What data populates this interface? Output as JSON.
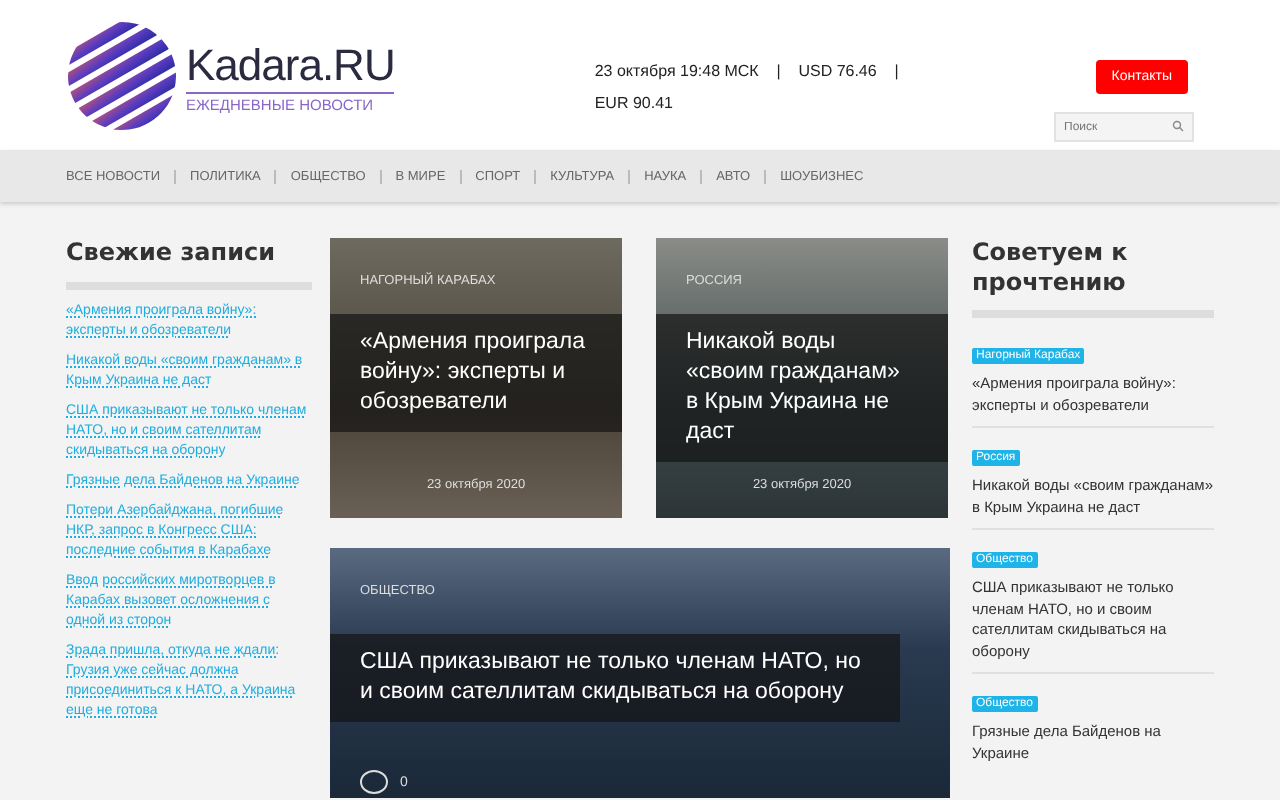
{
  "header": {
    "logo_name": "Kadara.RU",
    "logo_tagline": "ЕЖЕДНЕВНЫЕ НОВОСТИ",
    "info": "23 октября 19:48 МСК    |    USD 76.46    |    EUR 90.41",
    "contacts_button": "Контакты",
    "search": {
      "placeholder": "Поиск"
    }
  },
  "nav": [
    {
      "label": "ВСЕ НОВОСТИ"
    },
    {
      "label": "ПОЛИТИКА"
    },
    {
      "label": "ОБЩЕСТВО"
    },
    {
      "label": "В МИРЕ"
    },
    {
      "label": "СПОРТ"
    },
    {
      "label": "КУЛЬТУРА"
    },
    {
      "label": "НАУКА"
    },
    {
      "label": "АВТО"
    },
    {
      "label": "ШОУБИЗНЕС"
    }
  ],
  "fresh": {
    "title": "Свежие записи",
    "items": [
      "«Армения проиграла войну»: эксперты и обозреватели",
      "Никакой воды «своим гражданам» в Крым Украина не даст",
      "США приказывают не только членам НАТО, но и своим сателлитам скидываться на оборону",
      "Грязные дела Байденов на Украине",
      "Потери Азербайджана, погибшие НКР, запрос в Конгресс США: последние события в Карабахе",
      "Ввод российских миротворцев в Карабах вызовет осложнения с одной из сторон",
      "Зрада пришла, откуда не ждали: Грузия уже сейчас должна присоединиться к НАТО, а Украина еще не готова"
    ]
  },
  "cards": [
    {
      "kind": "small",
      "category": "НАГОРНЫЙ КАРАБАХ",
      "title": "«Армения проиграла войну»: эксперты и обозреватели",
      "date": "23 октября 2020"
    },
    {
      "kind": "small",
      "category": "РОССИЯ",
      "title": "Никакой воды «своим гражданам» в Крым Украина не даст",
      "date": "23 октября 2020"
    },
    {
      "kind": "wide",
      "category": "ОБЩЕСТВО",
      "title": "США приказывают не только членам НАТО, но и своим сателлитам скидываться на оборону",
      "comments": "0"
    }
  ],
  "recommended": {
    "title": "Советуем к прочтению",
    "items": [
      {
        "tag": "Нагорный Карабах",
        "title": "«Армения проиграла войну»: эксперты и обозреватели"
      },
      {
        "tag": "Россия",
        "title": "Никакой воды «своим гражданам» в Крым Украина не даст"
      },
      {
        "tag": "Общество",
        "title": "США приказывают не только членам НАТО, но и своим сателлитам скидываться на оборону"
      },
      {
        "tag": "Общество",
        "title": "Грязные дела Байденов на Украине"
      }
    ]
  }
}
